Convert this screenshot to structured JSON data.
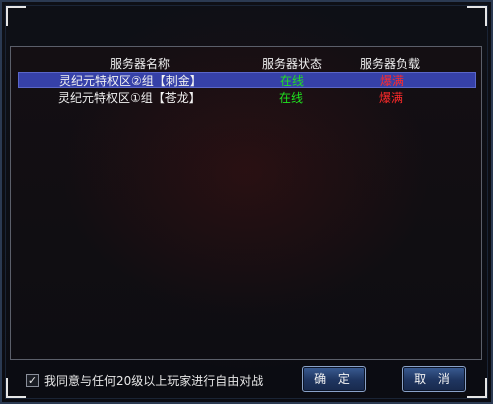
{
  "table": {
    "headers": [
      "服务器名称",
      "服务器状态",
      "服务器负载"
    ],
    "rows": [
      {
        "name": "灵纪元特权区②组【刺金】",
        "status": "在线",
        "load": "爆满",
        "selected": true
      },
      {
        "name": "灵纪元特权区①组【苍龙】",
        "status": "在线",
        "load": "爆满",
        "selected": false
      }
    ]
  },
  "agreement": {
    "checked": true,
    "check_glyph": "✓",
    "label": "我同意与任何20级以上玩家进行自由对战"
  },
  "buttons": {
    "confirm": "确 定",
    "cancel": "取 消"
  },
  "colors": {
    "status_online": "#1fe21f",
    "load_full": "#ff2a2a",
    "selection": "#3641a8"
  }
}
